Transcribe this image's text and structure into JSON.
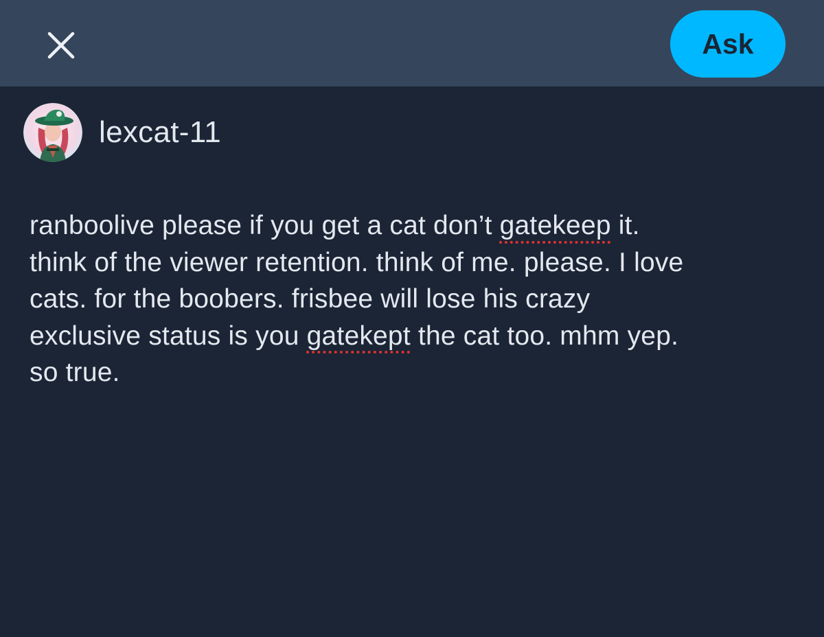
{
  "header": {
    "close_icon": "close-icon",
    "ask_label": "Ask",
    "ask_color": "#00b8ff",
    "background": "#35455c"
  },
  "post": {
    "author": "lexcat-11",
    "avatar_icon": "avatar",
    "body_segments": [
      "ranboolive please if you get a cat don’t ",
      "gatekeep",
      " it.\nthink of the viewer retention. think of me. please. I love\ncats. for the boobers. frisbee will lose his crazy\nexclusive status is you ",
      "gatekept",
      " the cat too. mhm yep.\nso true."
    ],
    "misspelled_color": "#e03131"
  },
  "theme": {
    "background": "#1b2535",
    "text": "#e4e8ef"
  }
}
